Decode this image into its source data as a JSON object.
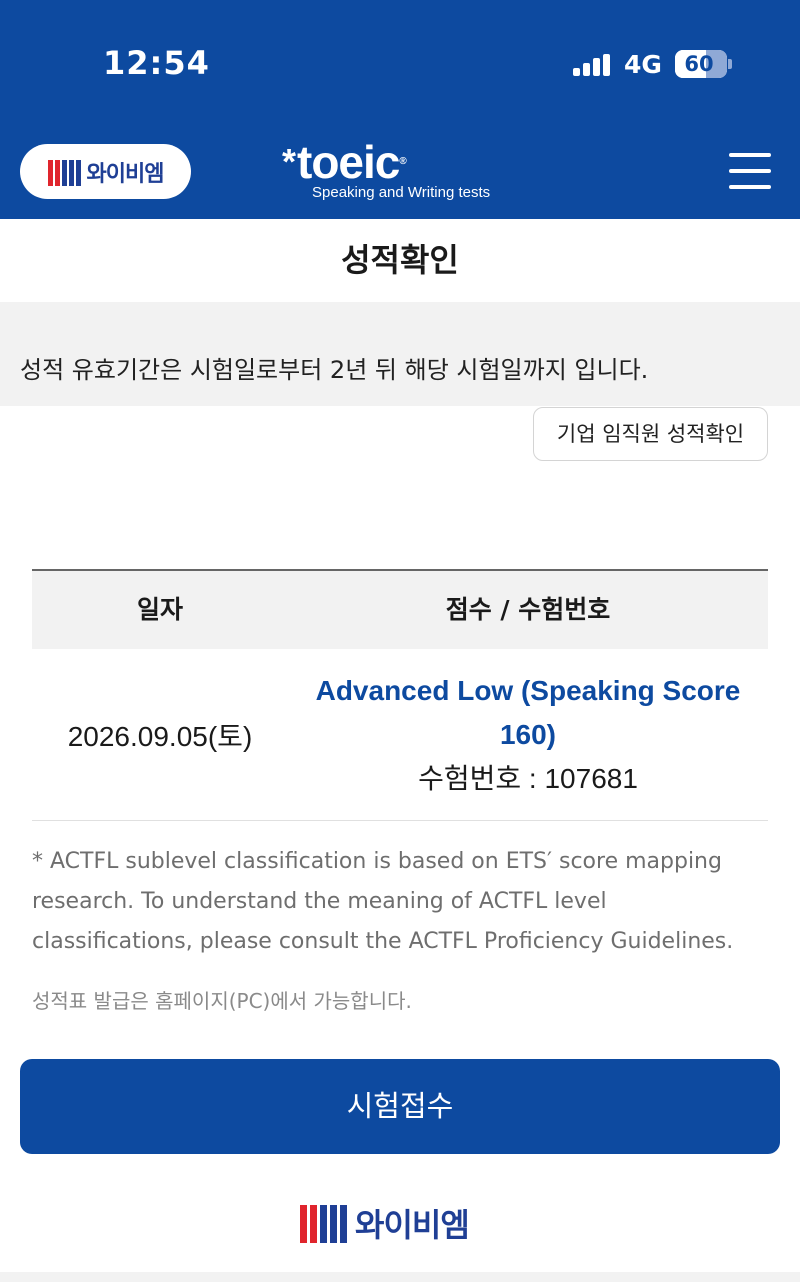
{
  "status_bar": {
    "time": "12:54",
    "network": "4G",
    "battery": "60",
    "battery_level": 60
  },
  "header": {
    "brand_text": "와이비엠",
    "toeic_word": "toeic",
    "toeic_star": "*",
    "toeic_reg": "®",
    "toeic_sub": "Speaking and Writing tests",
    "menu_icon": "hamburger-menu-icon"
  },
  "page": {
    "title": "성적확인",
    "notice": "성적 유효기간은 시험일로부터 2년 뒤 해당 시험일까지 입니다.",
    "corporate_button": "기업 임직원 성적확인"
  },
  "table": {
    "headers": [
      "일자",
      "점수 / 수험번호"
    ],
    "rows": [
      {
        "date": "2026.09.05(토)",
        "level": "Advanced Low (Speaking Score 160)",
        "reg_number": "수험번호 : 107681"
      }
    ]
  },
  "footnote": "* ACTFL sublevel classification is based on ETS′ score mapping research. To understand the meaning of ACTFL level classifications, please consult the ACTFL Proficiency Guidelines.",
  "pc_note": "성적표 발급은 홈페이지(PC)에서 가능합니다.",
  "apply_button": "시험접수",
  "footer": {
    "brand_text": "와이비엠"
  },
  "colors": {
    "primary": "#0d4aa0",
    "brand_red": "#e0252d",
    "brand_navy": "#1f3f95",
    "notice_bg": "#f2f2f2"
  }
}
